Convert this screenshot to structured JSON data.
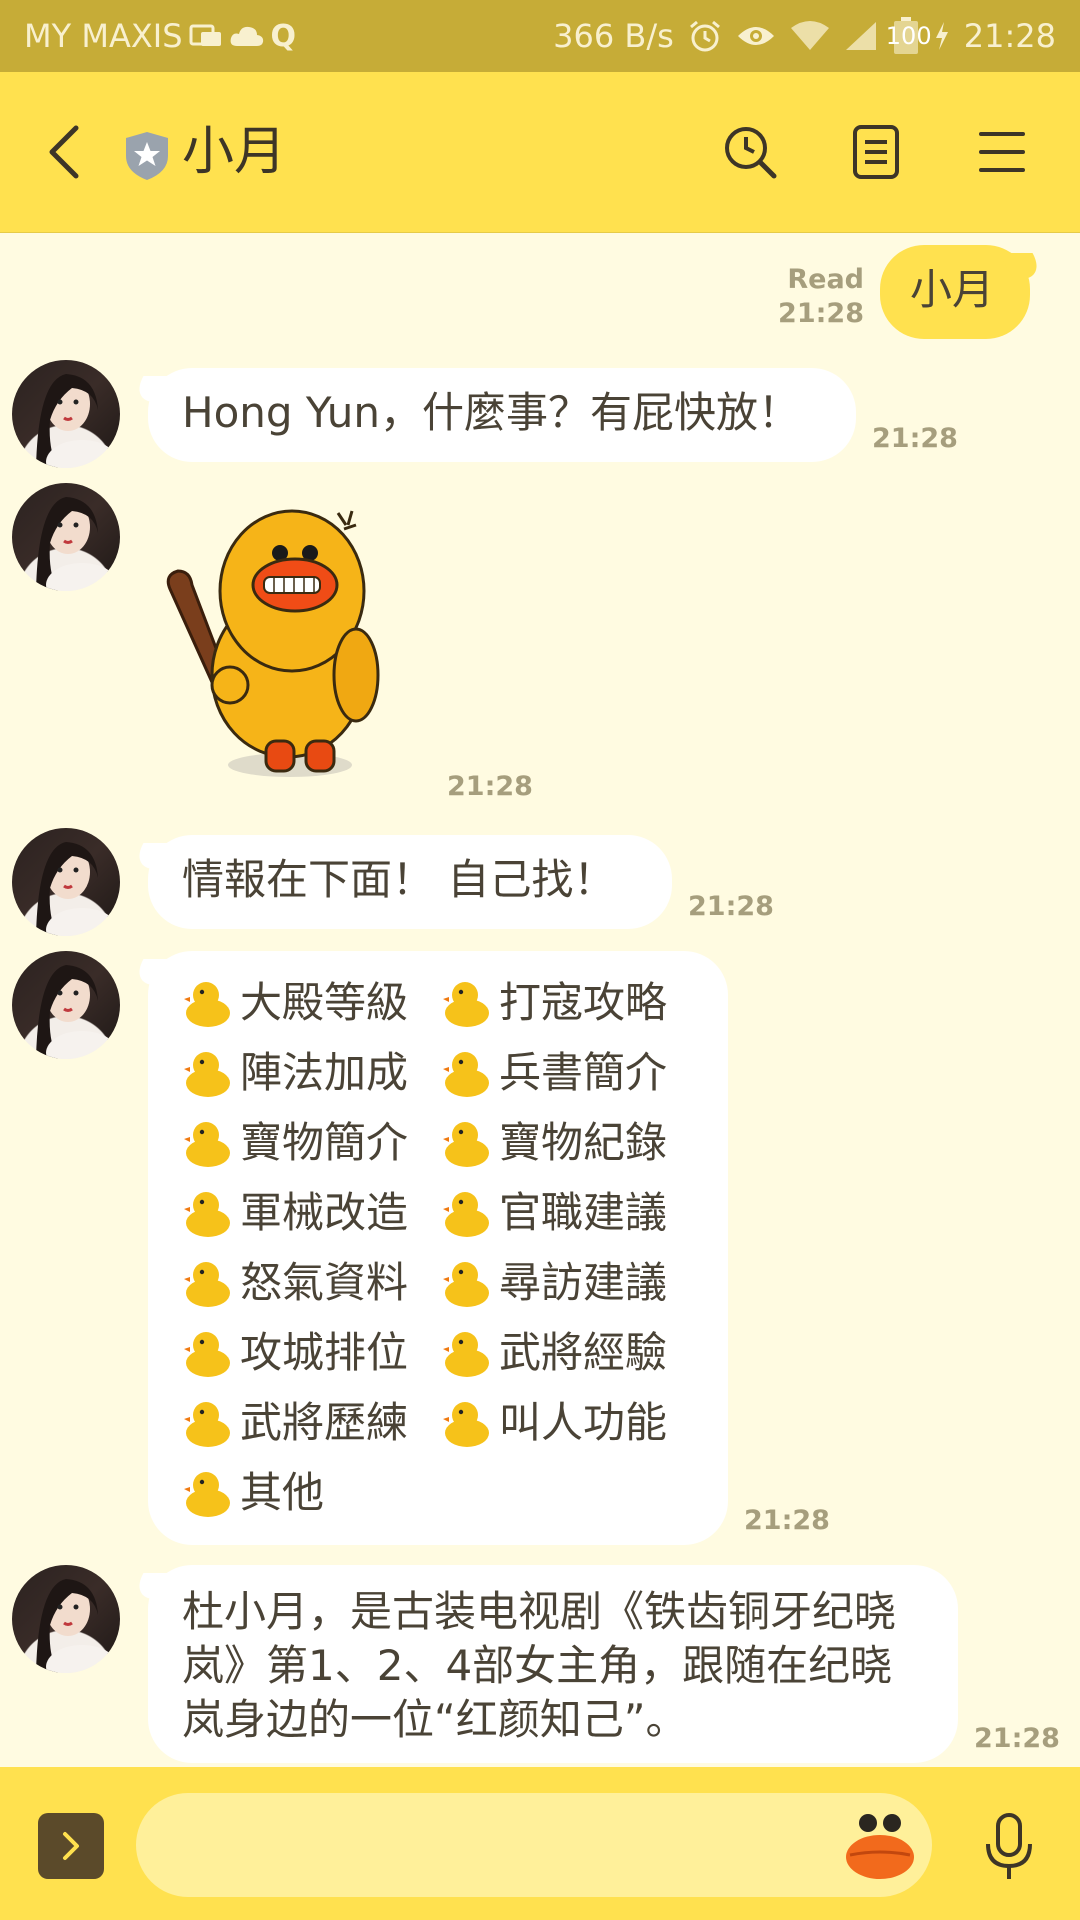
{
  "status_bar": {
    "carrier": "MY MAXIS",
    "speed": "366 B/s",
    "battery": "100",
    "time": "21:28",
    "icons": [
      "messages-icon",
      "cloud-icon",
      "q-icon",
      "alarm-icon",
      "eye-icon",
      "wifi-icon",
      "signal-icon",
      "battery-icon",
      "charging-icon"
    ]
  },
  "header": {
    "title": "小月",
    "icons": [
      "back-icon",
      "shield-star-icon",
      "search-icon",
      "notes-icon",
      "menu-icon"
    ]
  },
  "messages": [
    {
      "sender": "me",
      "text": "小月",
      "status": "Read",
      "time": "21:28"
    },
    {
      "sender": "小月",
      "text": "Hong Yun，什麼事？有屁快放！",
      "time": "21:28"
    },
    {
      "sender": "小月",
      "type": "sticker",
      "sticker": "angry-duck-with-bat",
      "time": "21:28"
    },
    {
      "sender": "小月",
      "text": "情報在下面！ 自己找！",
      "time": "21:28"
    },
    {
      "sender": "小月",
      "type": "menu",
      "items": [
        "大殿等級",
        "打寇攻略",
        "陣法加成",
        "兵書簡介",
        "寶物簡介",
        "寶物紀錄",
        "軍械改造",
        "官職建議",
        "怒氣資料",
        "尋訪建議",
        "攻城排位",
        "武將經驗",
        "武將歷練",
        "叫人功能",
        "其他"
      ],
      "time": "21:28"
    },
    {
      "sender": "小月",
      "text": "杜小月，是古装电视剧《铁齿铜牙纪晓岚》第1、2、4部女主角，跟随在纪晓岚身边的一位“红颜知己”。",
      "time": "21:28"
    }
  ],
  "input_bar": {
    "placeholder": "",
    "icons": [
      "expand-icon",
      "duck-emoji-icon",
      "microphone-icon"
    ]
  },
  "colors": {
    "header": "#ffe14f",
    "status_bar": "#c6ac37",
    "chat_background": "#fffbe1",
    "my_bubble": "#ffe14f",
    "their_bubble": "#ffffff",
    "time_text": "#a69e7d"
  }
}
